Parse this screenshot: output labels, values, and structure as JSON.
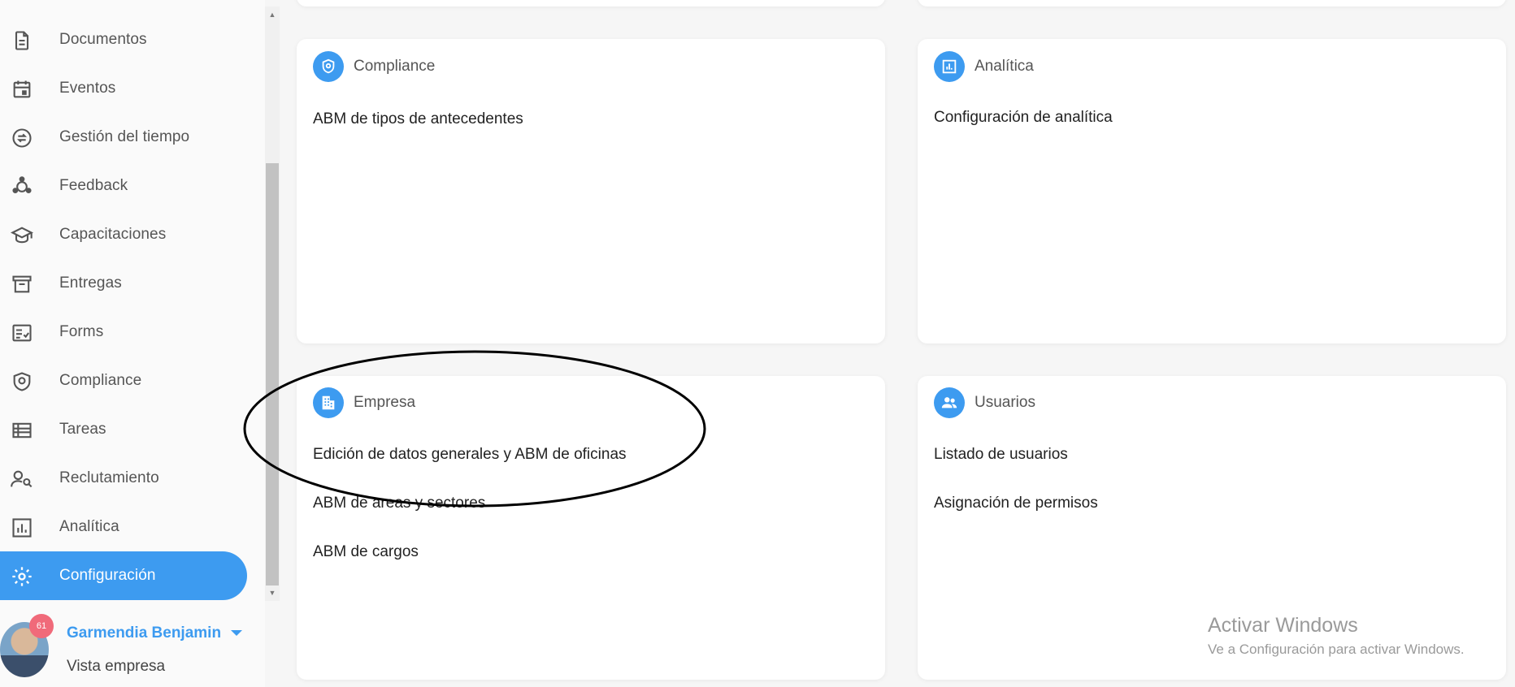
{
  "sidebar": {
    "items": [
      {
        "label": "Documentos",
        "icon": "document-icon"
      },
      {
        "label": "Eventos",
        "icon": "calendar-icon"
      },
      {
        "label": "Gestión del tiempo",
        "icon": "time-exchange-icon"
      },
      {
        "label": "Feedback",
        "icon": "feedback-icon"
      },
      {
        "label": "Capacitaciones",
        "icon": "graduation-cap-icon"
      },
      {
        "label": "Entregas",
        "icon": "archive-box-icon"
      },
      {
        "label": "Forms",
        "icon": "checklist-form-icon"
      },
      {
        "label": "Compliance",
        "icon": "shield-icon"
      },
      {
        "label": "Tareas",
        "icon": "task-list-icon"
      },
      {
        "label": "Reclutamiento",
        "icon": "person-search-icon"
      },
      {
        "label": "Analítica",
        "icon": "bar-chart-icon"
      },
      {
        "label": "Configuración",
        "icon": "gear-icon",
        "active": true
      }
    ],
    "accent_color": "#3d9bf0"
  },
  "user": {
    "name": "Garmendia Benjamin",
    "subtitle": "Vista empresa",
    "notification_count": "61"
  },
  "cards": {
    "compliance": {
      "title": "Compliance",
      "icon": "shield-icon",
      "links": [
        "ABM de tipos de antecedentes"
      ]
    },
    "analitica": {
      "title": "Analítica",
      "icon": "bar-chart-icon",
      "links": [
        "Configuración de analítica"
      ]
    },
    "empresa": {
      "title": "Empresa",
      "icon": "building-icon",
      "links": [
        "Edición de datos generales y ABM de oficinas",
        "ABM de areas y sectores",
        "ABM de cargos"
      ]
    },
    "usuarios": {
      "title": "Usuarios",
      "icon": "users-icon",
      "links": [
        "Listado de usuarios",
        "Asignación de permisos"
      ]
    }
  },
  "windows_watermark": {
    "title": "Activar Windows",
    "subtitle": "Ve a Configuración para activar Windows."
  }
}
